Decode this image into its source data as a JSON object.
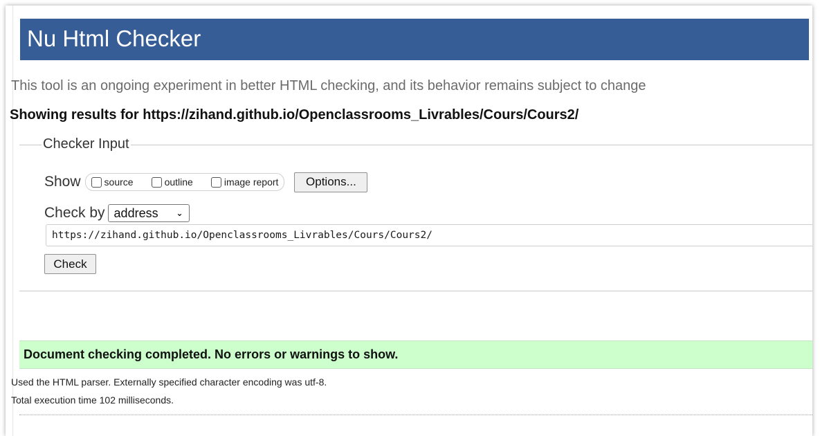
{
  "header": {
    "title": "Nu Html Checker"
  },
  "tagline": "This tool is an ongoing experiment in better HTML checking, and its behavior remains subject to change",
  "results_for": "Showing results for https://zihand.github.io/Openclassrooms_Livrables/Cours/Cours2/",
  "checker_input": {
    "legend": "Checker Input",
    "show_label": "Show",
    "show_options": [
      {
        "label": "source",
        "checked": false
      },
      {
        "label": "outline",
        "checked": false
      },
      {
        "label": "image report",
        "checked": false
      }
    ],
    "options_button": "Options...",
    "check_by_label": "Check by",
    "check_by_selected": "address",
    "url_value": "https://zihand.github.io/Openclassrooms_Livrables/Cours/Cours2/",
    "check_button": "Check"
  },
  "result": {
    "success_message": "Document checking completed. No errors or warnings to show.",
    "parser_info": "Used the HTML parser. Externally specified character encoding was utf-8.",
    "execution_time": "Total execution time 102 milliseconds.",
    "success_bg": "#ccffcc"
  },
  "colors": {
    "banner": "#365d95",
    "banner_text": "#ffffff"
  }
}
